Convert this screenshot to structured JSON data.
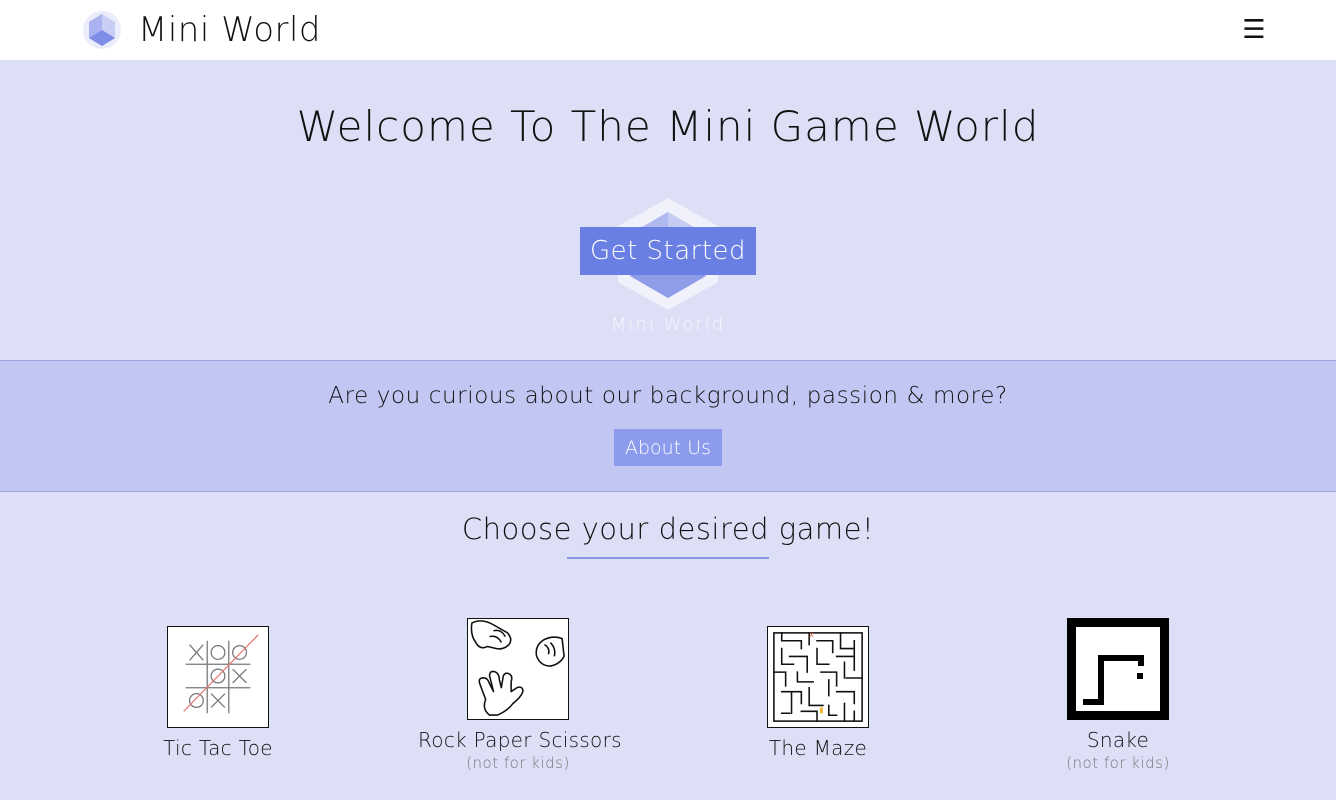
{
  "header": {
    "brand_name": "Mini World",
    "logo_icon": "cube-logo-icon",
    "menu_icon": "☰"
  },
  "hero": {
    "title": "Welcome To The Mini Game World",
    "cta_label": "Get Started",
    "watermark_text": "Mini World"
  },
  "about": {
    "question": "Are you curious about our background, passion & more?",
    "button_label": "About Us"
  },
  "games": {
    "title": "Choose your desired game!",
    "items": [
      {
        "name": "Tic Tac Toe",
        "note": "",
        "icon": "tic-tac-toe-icon"
      },
      {
        "name": "Rock Paper Scissors",
        "note": "(not for kids)",
        "icon": "hands-icon"
      },
      {
        "name": "The Maze",
        "note": "",
        "icon": "maze-icon"
      },
      {
        "name": "Snake",
        "note": "(not for kids)",
        "icon": "snake-icon"
      }
    ]
  },
  "colors": {
    "page_bg": "#dcdff5",
    "accent": "#6a7fe3",
    "about_band": "#c1c7f2",
    "about_button": "#8d9bec"
  }
}
